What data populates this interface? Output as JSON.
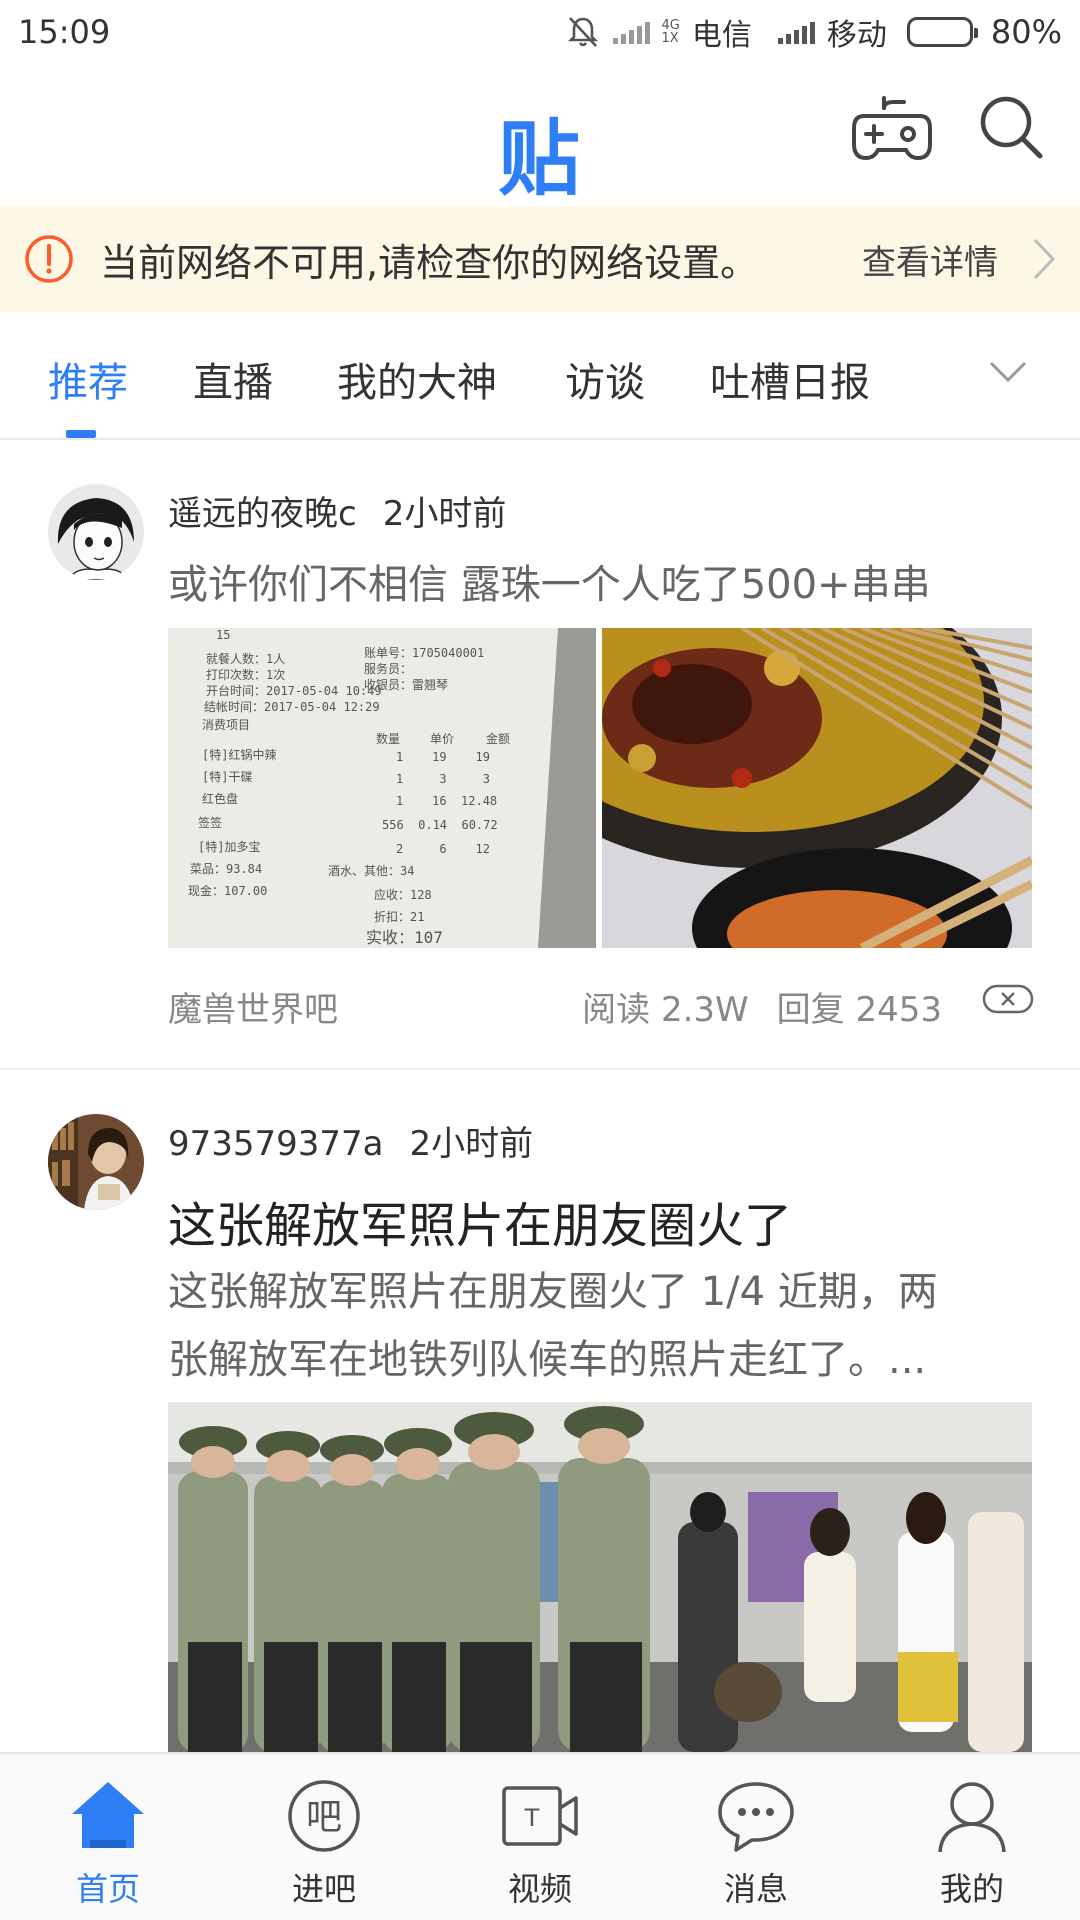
{
  "status_bar": {
    "time": "15:09",
    "carrier_1_net_top": "4G",
    "carrier_1_net_bottom": "1X",
    "carrier_1": "电信",
    "carrier_2": "移动",
    "battery": "80%",
    "battery_level": 0.8
  },
  "header": {
    "logo": "贴",
    "icons": [
      "gamepad-icon",
      "search-icon"
    ]
  },
  "network_warning": {
    "message": "当前网络不可用,请检查你的网络设置。",
    "detail_link": "查看详情"
  },
  "tabs": [
    {
      "label": "推荐",
      "active": true
    },
    {
      "label": "直播",
      "active": false
    },
    {
      "label": "我的大神",
      "active": false
    },
    {
      "label": "访谈",
      "active": false
    },
    {
      "label": "吐槽日报",
      "active": false
    }
  ],
  "posts": [
    {
      "author": "遥远的夜晚c",
      "time": "2小时前",
      "title": "或许你们不相信 露珠一个人吃了500+串串",
      "receipt": {
        "r0": "15",
        "r1": "就餐人数：1人",
        "r2": "账单号：1705040001",
        "r3": "打印次数：1次",
        "r4": "服务员：",
        "r5": "收银员：雷翘琴",
        "r6": "开台时间：2017-05-04 10:49",
        "r7": "结帐时间：2017-05-04 12:29",
        "r8": "消费项目",
        "h1": "数量",
        "h2": "单价",
        "h3": "金额",
        "i1": "[特]红锅中辣",
        "i1v": "1    19    19",
        "i2": "[特]干碟",
        "i2v": "1     3     3",
        "i3": "红色盘",
        "i3v": "1    16  12.48",
        "i4": "签签",
        "i4v": "556  0.14  60.72",
        "i5": "[特]加多宝",
        "i5v": "2     6    12",
        "t1": "菜品：93.84",
        "t2": "酒水、其他：34",
        "t3": "现金：107.00",
        "t4": "应收：128",
        "t5": "折扣：21",
        "t6": "实收：107"
      },
      "forum": "魔兽世界吧",
      "reads": "阅读 2.3W",
      "replies": "回复 2453"
    },
    {
      "author": "973579377a",
      "time": "2小时前",
      "title": "这张解放军照片在朋友圈火了",
      "abstract_line1": "这张解放军照片在朋友圈火了 1/4 近期，两",
      "abstract_line2": "张解放军在地铁列队候车的照片走红了。..."
    }
  ],
  "bottom_nav": [
    {
      "label": "首页",
      "icon": "home-icon",
      "active": true
    },
    {
      "label": "进吧",
      "icon": "enter-forum-icon",
      "glyph": "吧",
      "active": false
    },
    {
      "label": "视频",
      "icon": "video-icon",
      "glyph": "T",
      "active": false
    },
    {
      "label": "消息",
      "icon": "message-icon",
      "glyph": "•••",
      "active": false
    },
    {
      "label": "我的",
      "icon": "profile-icon",
      "active": false
    }
  ],
  "colors": {
    "accent": "#2e7ef6",
    "warning_bg": "#fdf7e6",
    "warning_icon": "#ff5a2a"
  }
}
